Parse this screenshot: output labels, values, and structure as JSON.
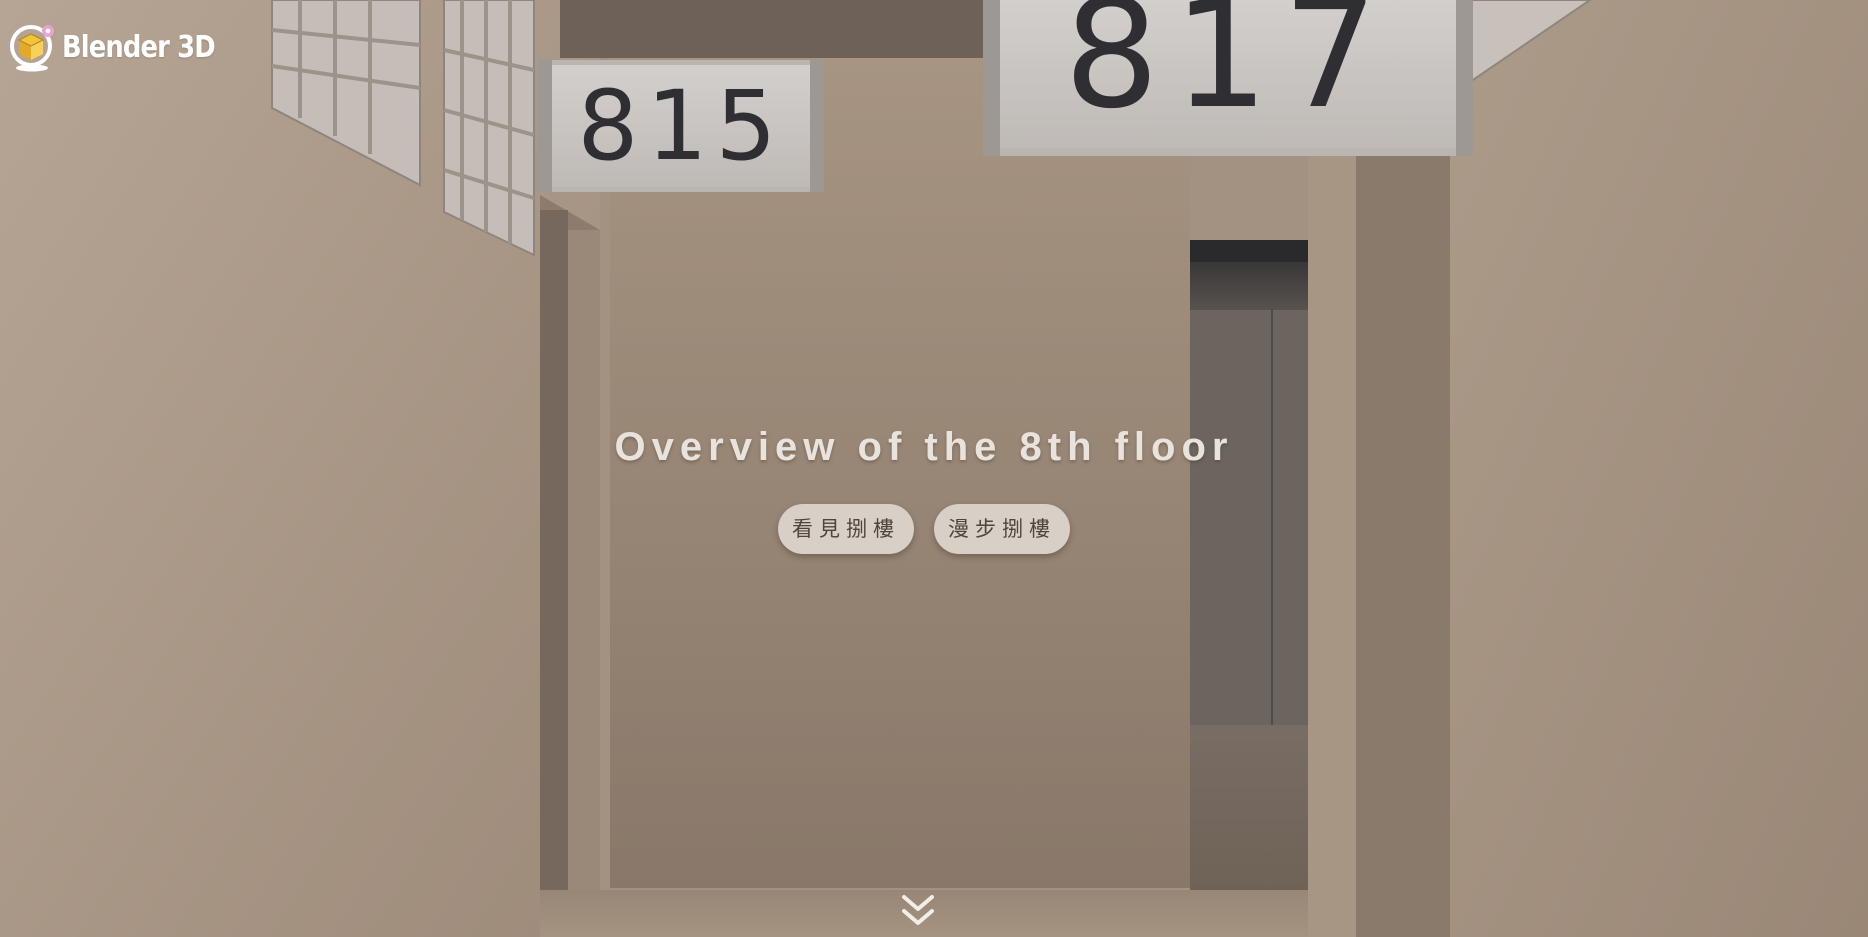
{
  "brand": {
    "name": "Blender 3D",
    "icon": "box-globe-logo-icon"
  },
  "hero": {
    "title": "Overview of the 8th floor",
    "buttons": [
      {
        "label": "看見捌樓"
      },
      {
        "label": "漫步捌樓"
      }
    ]
  },
  "scene": {
    "signs": {
      "left": "815",
      "right": "817"
    }
  },
  "scroll": {
    "icon": "double-chevron-down-icon"
  },
  "colors": {
    "wall": "#a69585",
    "sign_face": "#cfcbc8",
    "sign_text": "#2f2e33",
    "button_bg": "#d8cfc7",
    "title_text": "#e9e3dd"
  }
}
